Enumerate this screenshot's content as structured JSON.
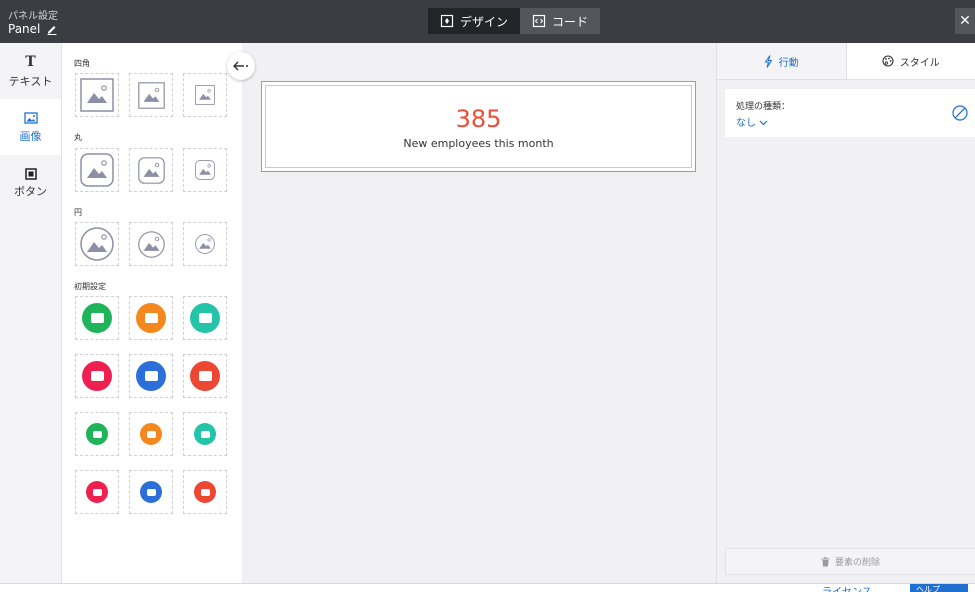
{
  "header": {
    "small_title": "パネル設定",
    "panel_name": "Panel",
    "tabs": [
      {
        "label": "デザイン",
        "icon": "design-icon",
        "active": true
      },
      {
        "label": "コード",
        "icon": "code-icon",
        "active": false
      }
    ],
    "close": "✕"
  },
  "rail": {
    "items": [
      {
        "label": "テキスト",
        "icon": "text-icon",
        "glyph": "T",
        "active": false
      },
      {
        "label": "画像",
        "icon": "image-icon",
        "active": true
      },
      {
        "label": "ボタン",
        "icon": "button-icon",
        "active": false
      }
    ]
  },
  "library": {
    "sections": [
      {
        "label": "四角"
      },
      {
        "label": "丸"
      },
      {
        "label": "円"
      },
      {
        "label": "初期設定"
      }
    ],
    "preset_colors": [
      [
        "#1fb45a",
        "#f5871f",
        "#23c4a8"
      ],
      [
        "#ef1f4f",
        "#2d6fd8",
        "#eb4733"
      ],
      [
        "#1fb45a",
        "#f5871f",
        "#23c4a8"
      ],
      [
        "#ef1f4f",
        "#2d6fd8",
        "#eb4733"
      ]
    ],
    "collapse_icon": "arrow-left-icon"
  },
  "canvas": {
    "metric_value": "385",
    "metric_caption": "New employees this month",
    "accent": "#e8503a"
  },
  "properties": {
    "tabs": [
      {
        "label": "行動",
        "icon": "lightning-icon",
        "active": true
      },
      {
        "label": "スタイル",
        "icon": "palette-icon",
        "active": false
      }
    ],
    "action_type_label": "処理の種類：",
    "action_type_value": "なし",
    "delete_label": "要素の削除"
  },
  "footer": {
    "license": "ライセンス",
    "help": "ヘルプ"
  }
}
